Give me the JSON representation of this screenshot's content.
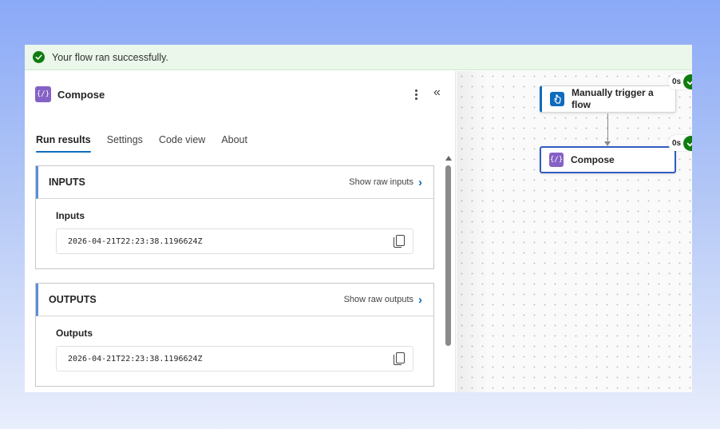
{
  "banner": {
    "message": "Your flow ran successfully."
  },
  "panel": {
    "title": "Compose",
    "icon": "compose-icon",
    "tabs": [
      {
        "label": "Run results",
        "active": true
      },
      {
        "label": "Settings",
        "active": false
      },
      {
        "label": "Code view",
        "active": false
      },
      {
        "label": "About",
        "active": false
      }
    ],
    "inputs": {
      "header": "INPUTS",
      "raw_link": "Show raw inputs",
      "label": "Inputs",
      "value": "2026-04-21T22:23:38.1196624Z"
    },
    "outputs": {
      "header": "OUTPUTS",
      "raw_link": "Show raw outputs",
      "label": "Outputs",
      "value": "2026-04-21T22:23:38.1196624Z"
    }
  },
  "canvas": {
    "nodes": [
      {
        "label": "Manually trigger a flow",
        "duration": "0s",
        "status": "succeeded",
        "icon": "manual-trigger-icon"
      },
      {
        "label": "Compose",
        "duration": "0s",
        "status": "succeeded",
        "icon": "compose-icon"
      }
    ]
  },
  "colors": {
    "accent": "#0f6cbd",
    "success": "#107c10",
    "compose": "#8661c5"
  }
}
